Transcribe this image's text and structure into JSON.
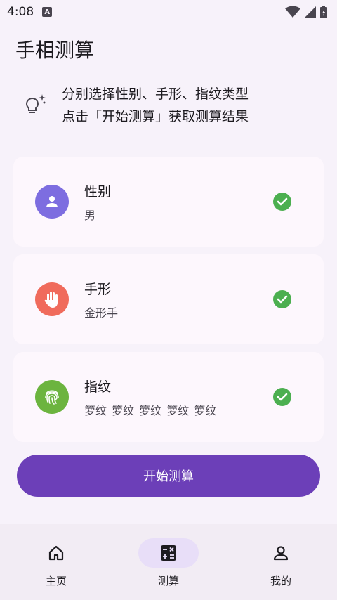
{
  "status_bar": {
    "time": "4:08",
    "indicator": "A"
  },
  "page": {
    "title": "手相测算"
  },
  "tip": {
    "line1": "分别选择性别、手形、指纹类型",
    "line2": "点击「开始测算」获取测算结果",
    "icon": "lightbulb-sparkle-icon"
  },
  "cards": [
    {
      "title": "性别",
      "value": "男",
      "icon": "person-icon",
      "color": "#7d6de0",
      "checked": true
    },
    {
      "title": "手形",
      "value": "金形手",
      "icon": "hand-icon",
      "color": "#f06b5c",
      "checked": true
    },
    {
      "title": "指纹",
      "value": "箩纹 箩纹 箩纹 箩纹 箩纹",
      "icon": "fingerprint-icon",
      "color": "#6cb43f",
      "checked": true
    }
  ],
  "start_button": {
    "label": "开始测算"
  },
  "nav": {
    "items": [
      {
        "label": "主页",
        "icon": "home-icon"
      },
      {
        "label": "测算",
        "icon": "calculator-icon",
        "active": true
      },
      {
        "label": "我的",
        "icon": "profile-icon"
      }
    ]
  },
  "colors": {
    "accent": "#6c3fb8",
    "check": "#4caf50",
    "background": "#f7f2fa"
  }
}
